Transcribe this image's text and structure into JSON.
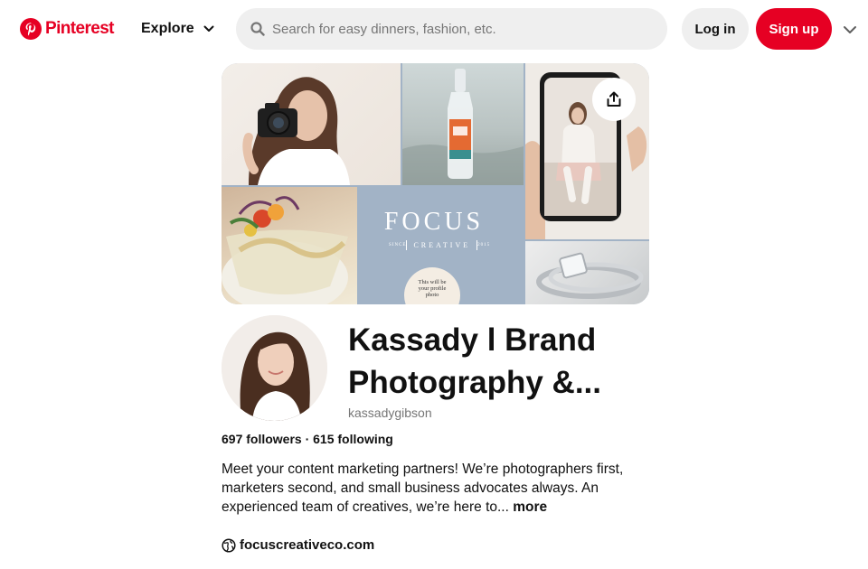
{
  "header": {
    "brand": "Pinterest",
    "explore_label": "Explore",
    "search_placeholder": "Search for easy dinners, fashion, etc.",
    "login_label": "Log in",
    "signup_label": "Sign up"
  },
  "cover": {
    "focus_title": "FOCUS",
    "focus_subtitle": "CREATIVE",
    "focus_since_left": "SINCE",
    "focus_since_right": "2015",
    "profile_bubble_text": "This will be your profile photo"
  },
  "profile": {
    "name": "Kassady l Brand Photography &...",
    "username": "kassadygibson",
    "stats": "697 followers · 615 following",
    "bio": "Meet your content marketing partners! We’re photographers first, marketers second, and small business advocates always. An experienced team of creatives, we’re here to...",
    "bio_more": " more",
    "website": "focuscreativeco.com"
  },
  "colors": {
    "brand_red": "#e60023",
    "button_gray": "#efefef",
    "cover_blue": "#a2b3c6"
  },
  "icons": [
    "pinterest-logo-icon",
    "chevron-down-icon",
    "search-icon",
    "share-icon",
    "globe-icon"
  ]
}
